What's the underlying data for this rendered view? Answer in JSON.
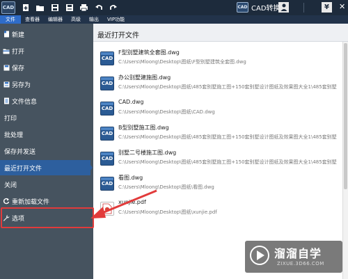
{
  "toolbar": {
    "app_logo": "CAD",
    "icons": [
      "new-file-icon",
      "open-folder-icon",
      "save-icon",
      "save-as-icon",
      "print-icon",
      "undo-icon",
      "redo-icon"
    ],
    "cad_badge": "CAD",
    "cad_convert_label": "CAD转换",
    "close_glyph": "✕"
  },
  "menubar": {
    "items": [
      "文件",
      "查看器",
      "编辑器",
      "高级",
      "输出",
      "VIP功能"
    ]
  },
  "sidebar": {
    "items": [
      {
        "label": "新建",
        "icon": "new-icon"
      },
      {
        "label": "打开",
        "icon": "open-icon"
      },
      {
        "label": "保存",
        "icon": "save-icon"
      },
      {
        "label": "另存为",
        "icon": "save-as-icon"
      },
      {
        "label": "文件信息",
        "icon": "file-info-icon"
      },
      {
        "label": "打印",
        "icon": ""
      },
      {
        "label": "批处理",
        "icon": ""
      },
      {
        "label": "保存并发送",
        "icon": ""
      },
      {
        "label": "最近打开文件",
        "icon": ""
      },
      {
        "label": "关闭",
        "icon": ""
      },
      {
        "label": "重新加载文件",
        "icon": "reload-icon"
      },
      {
        "label": "选项",
        "icon": "wrench-icon"
      }
    ],
    "active_index": 8,
    "highlighted_index": 11
  },
  "main": {
    "title": "最近打开文件",
    "files": [
      {
        "name": "F型别墅建筑全套图.dwg",
        "path": "C:\\Users\\Mloong\\Desktop\\图纸\\F型别墅建筑全套图.dwg",
        "type": "dwg",
        "icon_text": "CAD"
      },
      {
        "name": "办公别墅建施图.dwg",
        "path": "C:\\Users\\Mloong\\Desktop\\图纸\\485套别墅施工图+150套别墅设计图纸及效果图大全1\\485套别墅",
        "type": "dwg",
        "icon_text": "CAD"
      },
      {
        "name": "CAD.dwg",
        "path": "C:\\Users\\Mloong\\Desktop\\图纸\\CAD.dwg",
        "type": "dwg",
        "icon_text": "CAD"
      },
      {
        "name": "B型别墅施工图.dwg",
        "path": "C:\\Users\\Mloong\\Desktop\\图纸\\485套别墅施工图+150套别墅设计图纸及效果图大全1\\485套别墅",
        "type": "dwg",
        "icon_text": "CAD"
      },
      {
        "name": "别墅二号楼施工图.dwg",
        "path": "C:\\Users\\Mloong\\Desktop\\图纸\\485套别墅施工图+150套别墅设计图纸及效果图大全1\\485套别墅",
        "type": "dwg",
        "icon_text": "CAD"
      },
      {
        "name": "看图.dwg",
        "path": "C:\\Users\\Mloong\\Desktop\\图纸\\看图.dwg",
        "type": "dwg",
        "icon_text": "CAD"
      },
      {
        "name": "xunjie.pdf",
        "path": "C:\\Users\\Mloong\\Desktop\\图纸\\xunjie.pdf",
        "type": "pdf",
        "icon_text": ""
      }
    ]
  },
  "watermark": {
    "title": "溜溜自学",
    "subtitle": "ZIXUE.3D66.COM"
  },
  "colors": {
    "toolbar_bg": "#1d2b3c",
    "sidebar_bg": "#46535f",
    "active_item": "#2d5f9e",
    "menu_active": "#2f6cc8",
    "annotation_red": "#e23b3b"
  }
}
